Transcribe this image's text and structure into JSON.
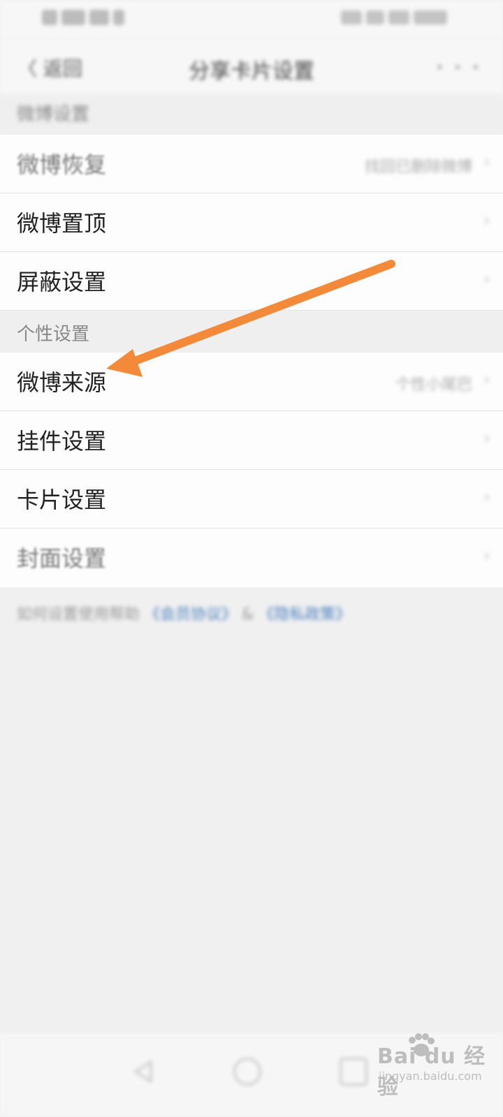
{
  "status_bar": {
    "left_icons": "signal-wifi-icons",
    "right_icons": "battery-time-icons"
  },
  "nav": {
    "back_label": "〈 返回",
    "title": "分享卡片设置",
    "more": "• • •"
  },
  "sections": [
    {
      "header": "微博设置",
      "rows": [
        {
          "label": "微博恢复",
          "value": "找回已删除微博",
          "muted": true
        },
        {
          "label": "微博置顶",
          "value": "",
          "muted": false
        },
        {
          "label": "屏蔽设置",
          "value": "",
          "muted": false
        }
      ]
    },
    {
      "header": "个性设置",
      "rows": [
        {
          "label": "微博来源",
          "value": "个性小尾巴",
          "muted": false
        },
        {
          "label": "挂件设置",
          "value": "",
          "muted": false
        },
        {
          "label": "卡片设置",
          "value": "",
          "muted": false
        },
        {
          "label": "封面设置",
          "value": "",
          "muted": true
        }
      ]
    }
  ],
  "footer": {
    "text": "如何设置使用帮助",
    "link1": "《会员协议》",
    "sep": "&",
    "link2": "《隐私政策》"
  },
  "watermark": {
    "brand": "Bai du 经验",
    "sub": "jingyan.baidu.com"
  },
  "annotation": {
    "arrow_color": "#f28a3a"
  },
  "colors": {
    "background": "#f0f0f0",
    "row_bg": "#fdfdfd",
    "link": "#4a7fc0"
  }
}
